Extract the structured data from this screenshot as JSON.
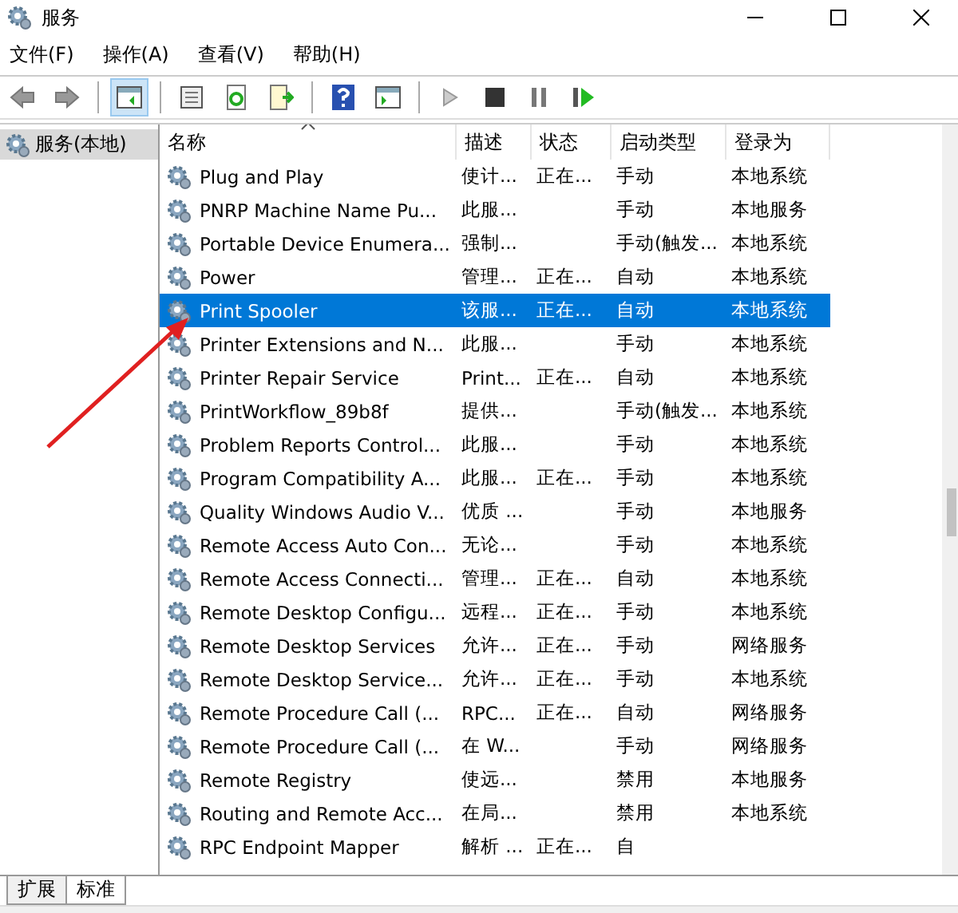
{
  "window": {
    "title": "服务"
  },
  "menu": [
    "文件(F)",
    "操作(A)",
    "查看(V)",
    "帮助(H)"
  ],
  "sidebar": {
    "items": [
      {
        "label": "服务(本地)",
        "selected": true
      }
    ]
  },
  "table": {
    "columns": [
      "名称",
      "描述",
      "状态",
      "启动类型",
      "登录为"
    ],
    "rows": [
      {
        "cells": [
          "Plug and Play",
          "使计...",
          "正在...",
          "手动",
          "本地系统"
        ],
        "selected": false
      },
      {
        "cells": [
          "PNRP Machine Name Pu...",
          "此服...",
          "",
          "手动",
          "本地服务"
        ],
        "selected": false
      },
      {
        "cells": [
          "Portable Device Enumera...",
          "强制...",
          "",
          "手动(触发...",
          "本地系统"
        ],
        "selected": false
      },
      {
        "cells": [
          "Power",
          "管理...",
          "正在...",
          "自动",
          "本地系统"
        ],
        "selected": false
      },
      {
        "cells": [
          "Print Spooler",
          "该服...",
          "正在...",
          "自动",
          "本地系统"
        ],
        "selected": true
      },
      {
        "cells": [
          "Printer Extensions and N...",
          "此服...",
          "",
          "手动",
          "本地系统"
        ],
        "selected": false
      },
      {
        "cells": [
          "Printer Repair Service",
          "Print...",
          "正在...",
          "自动",
          "本地系统"
        ],
        "selected": false
      },
      {
        "cells": [
          "PrintWorkflow_89b8f",
          "提供...",
          "",
          "手动(触发...",
          "本地系统"
        ],
        "selected": false
      },
      {
        "cells": [
          "Problem Reports Control...",
          "此服...",
          "",
          "手动",
          "本地系统"
        ],
        "selected": false
      },
      {
        "cells": [
          "Program Compatibility A...",
          "此服...",
          "正在...",
          "手动",
          "本地系统"
        ],
        "selected": false
      },
      {
        "cells": [
          "Quality Windows Audio V...",
          "优质 ...",
          "",
          "手动",
          "本地服务"
        ],
        "selected": false
      },
      {
        "cells": [
          "Remote Access Auto Con...",
          "无论...",
          "",
          "手动",
          "本地系统"
        ],
        "selected": false
      },
      {
        "cells": [
          "Remote Access Connecti...",
          "管理...",
          "正在...",
          "自动",
          "本地系统"
        ],
        "selected": false
      },
      {
        "cells": [
          "Remote Desktop Configu...",
          "远程...",
          "正在...",
          "手动",
          "本地系统"
        ],
        "selected": false
      },
      {
        "cells": [
          "Remote Desktop Services",
          "允许...",
          "正在...",
          "手动",
          "网络服务"
        ],
        "selected": false
      },
      {
        "cells": [
          "Remote Desktop Service...",
          "允许...",
          "正在...",
          "手动",
          "本地系统"
        ],
        "selected": false
      },
      {
        "cells": [
          "Remote Procedure Call (...",
          "RPC...",
          "正在...",
          "自动",
          "网络服务"
        ],
        "selected": false
      },
      {
        "cells": [
          "Remote Procedure Call (...",
          "在 W...",
          "",
          "手动",
          "网络服务"
        ],
        "selected": false
      },
      {
        "cells": [
          "Remote Registry",
          "使远...",
          "",
          "禁用",
          "本地服务"
        ],
        "selected": false
      },
      {
        "cells": [
          "Routing and Remote Acc...",
          "在局...",
          "",
          "禁用",
          "本地系统"
        ],
        "selected": false
      },
      {
        "cells": [
          "RPC Endpoint Mapper",
          "解析 ...",
          "正在...",
          "自",
          ""
        ],
        "selected": false
      }
    ]
  },
  "tabs": [
    {
      "label": "扩展",
      "selected": false
    },
    {
      "label": "标准",
      "selected": true
    }
  ]
}
